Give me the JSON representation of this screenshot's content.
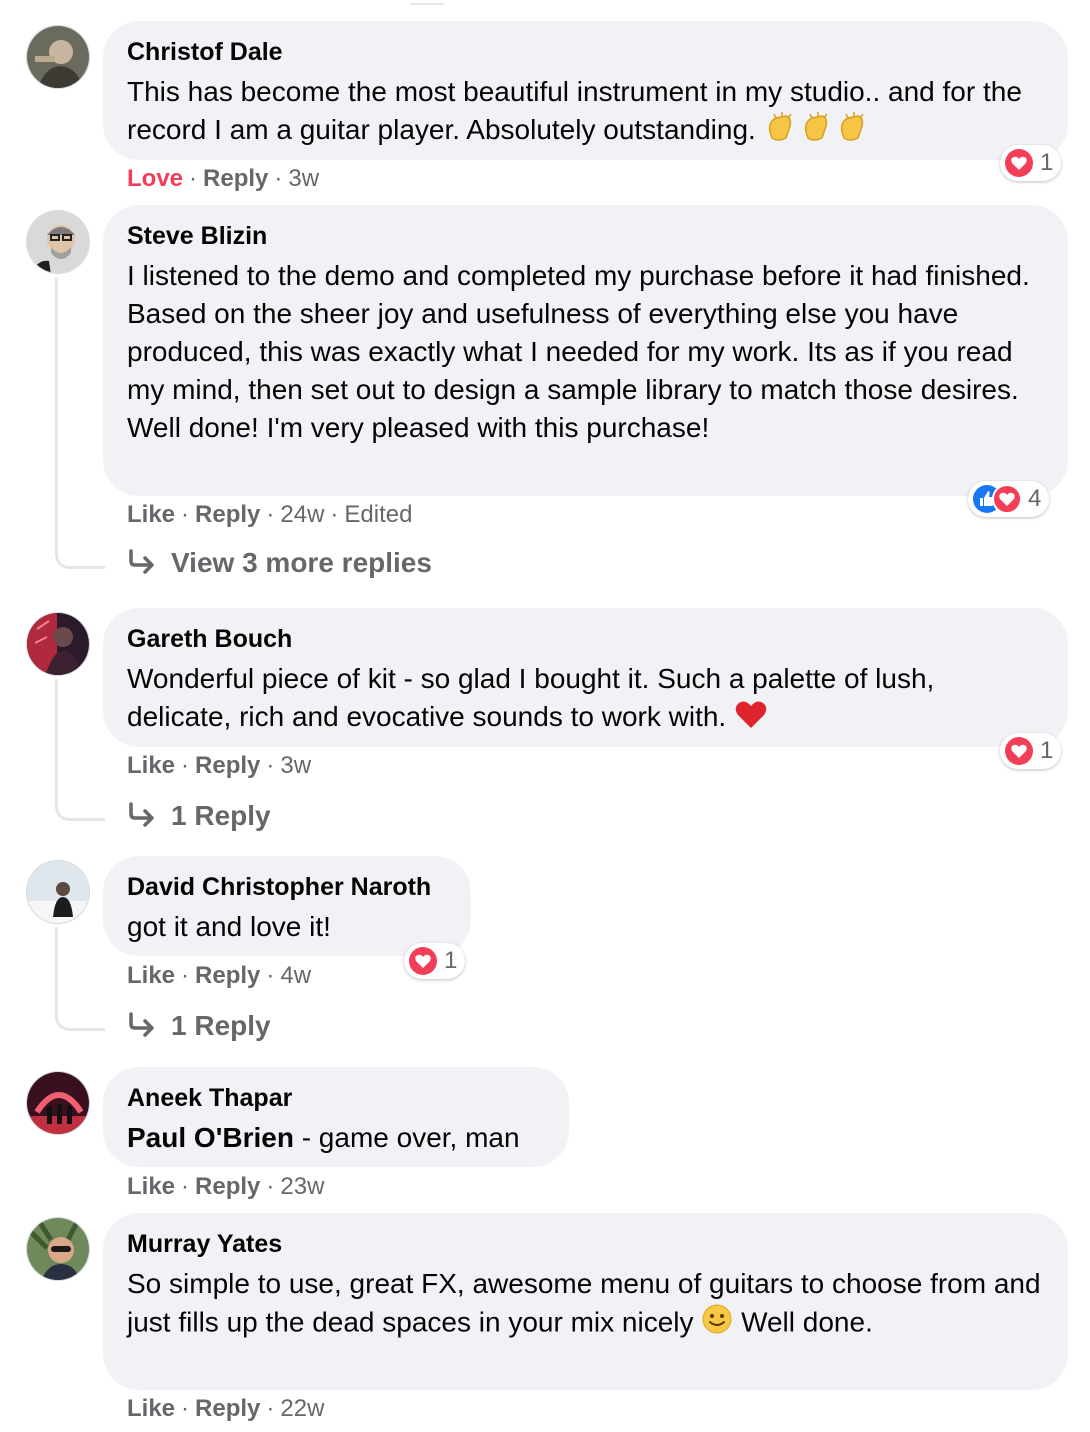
{
  "comments": [
    {
      "author": "Christof Dale",
      "text": "This has become the most beautiful instrument in my studio.. and for the record I am a guitar player. Absolutely outstanding.",
      "emoji_icons": [
        "clapping-hands-icon",
        "clapping-hands-icon",
        "clapping-hands-icon"
      ],
      "action_reaction": "Love",
      "action_reply": "Reply",
      "time": "3w",
      "reaction_icons": [
        "heart-icon"
      ],
      "reaction_count": "1"
    },
    {
      "author": "Steve Blizin",
      "text": "I listened to the demo and completed my purchase before it had finished. Based on the sheer joy and usefulness of everything else you have produced, this was exactly what I needed for my work. Its as if you read my mind, then set out to design a sample library to match those desires. Well done! I'm very pleased with this purchase!",
      "action_reaction": "Like",
      "action_reply": "Reply",
      "time": "24w",
      "edited": "Edited",
      "reaction_icons": [
        "like-icon",
        "heart-icon"
      ],
      "reaction_count": "4",
      "replies_link": "View 3 more replies"
    },
    {
      "author": "Gareth Bouch",
      "text": "Wonderful piece of kit - so glad I bought it. Such a palette of lush, delicate, rich and evocative sounds to work with.",
      "emoji_icons": [
        "red-heart-icon"
      ],
      "action_reaction": "Like",
      "action_reply": "Reply",
      "time": "3w",
      "reaction_icons": [
        "heart-icon"
      ],
      "reaction_count": "1",
      "replies_link": "1 Reply"
    },
    {
      "author": "David Christopher Naroth",
      "text": "got it and love it!",
      "action_reaction": "Like",
      "action_reply": "Reply",
      "time": "4w",
      "reaction_icons": [
        "heart-icon"
      ],
      "reaction_count": "1",
      "replies_link": "1 Reply"
    },
    {
      "author": "Aneek Thapar",
      "mention": "Paul O'Brien",
      "text": " - game over, man",
      "action_reaction": "Like",
      "action_reply": "Reply",
      "time": "23w"
    },
    {
      "author": "Murray Yates",
      "text_part1": "So simple to use, great FX, awesome menu of guitars to choose from and just fills up the dead spaces in your mix nicely",
      "text_part2": "Well done.",
      "emoji_icons": [
        "smiling-face-icon"
      ],
      "action_reaction": "Like",
      "action_reply": "Reply",
      "time": "22w"
    }
  ],
  "separator": "·",
  "colors": {
    "bubble": "#f0f2f5",
    "secondary_text": "#65676b",
    "love": "#f33e58",
    "like_blue": "#1877f2",
    "thread_line": "#e4e6eb"
  }
}
